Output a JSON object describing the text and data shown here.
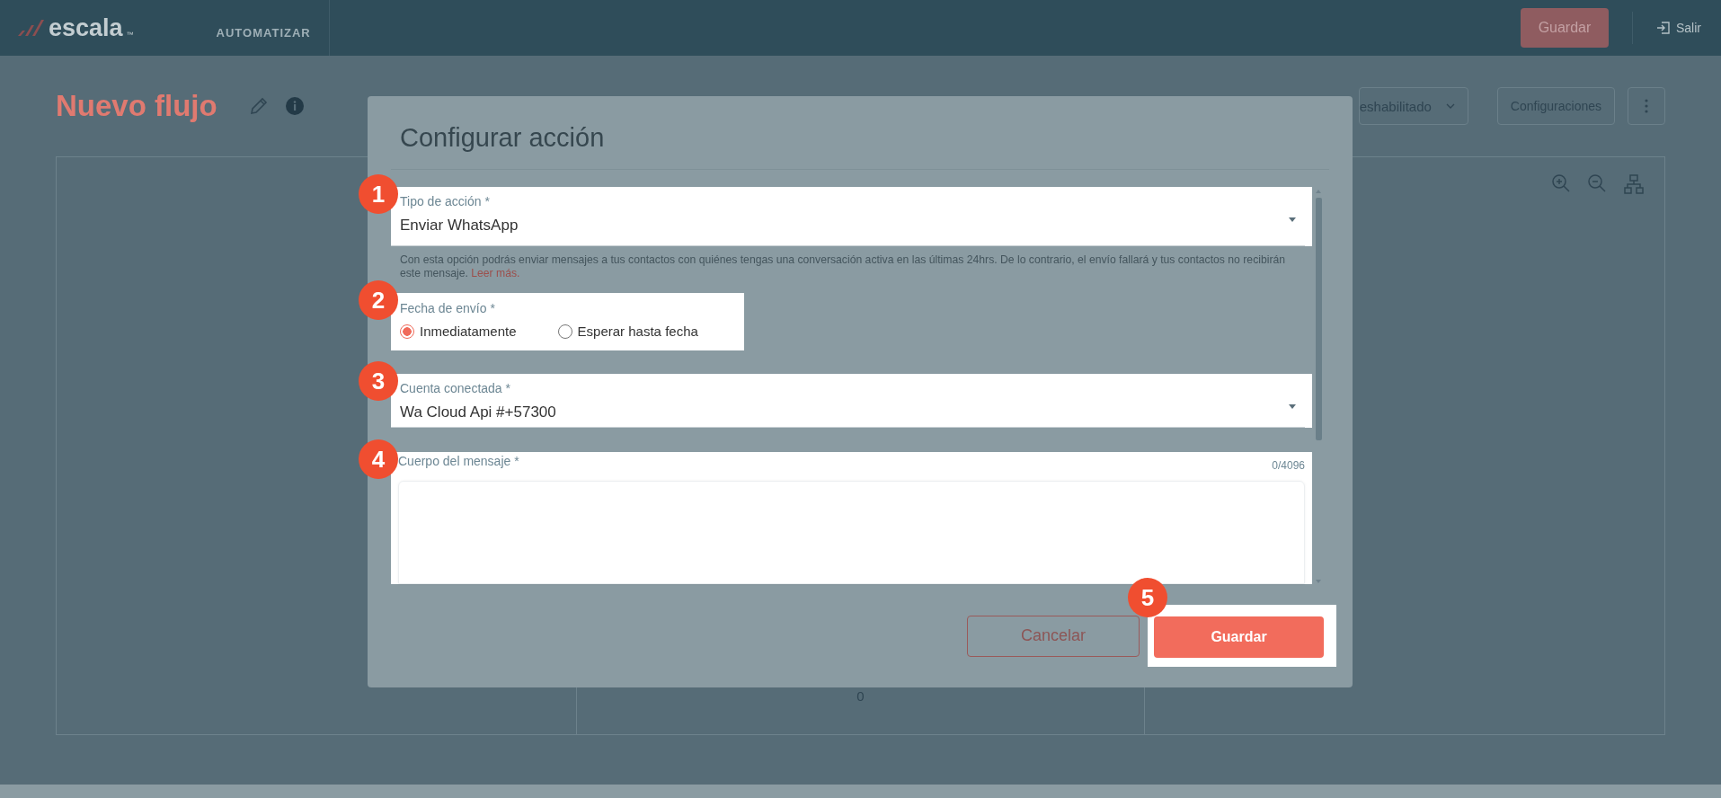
{
  "header": {
    "logo": "escala",
    "logo_mark": "™",
    "section": "AUTOMATIZAR",
    "save_button": "Guardar",
    "exit_link": "Salir"
  },
  "page": {
    "title": "Nuevo flujo",
    "status_dropdown": "eshabilitado",
    "settings_button": "Configuraciones",
    "canvas_count": "0"
  },
  "modal": {
    "title": "Configurar acción",
    "fields": [
      {
        "kind": "select",
        "step": "1",
        "label": "Tipo de acción *",
        "value": "Enviar WhatsApp",
        "help": "Con esta opción podrás enviar mensajes a tus contactos con quiénes tengas una conversación activa en las últimas 24hrs. De lo contrario, el envío fallará y tus contactos no recibirán este mensaje.",
        "help_link": "Leer más."
      },
      {
        "kind": "radio",
        "step": "2",
        "label": "Fecha de envío *",
        "options": [
          {
            "label": "Inmediatamente",
            "selected": true
          },
          {
            "label": "Esperar hasta fecha",
            "selected": false
          }
        ]
      },
      {
        "kind": "select",
        "step": "3",
        "label": "Cuenta conectada *",
        "value": "Wa Cloud Api #+57300"
      },
      {
        "kind": "textarea",
        "step": "4",
        "label": "Cuerpo del mensaje *",
        "counter": "0/4096"
      }
    ],
    "cancel_button": "Cancelar",
    "save_button": "Guardar",
    "save_step": "5"
  }
}
